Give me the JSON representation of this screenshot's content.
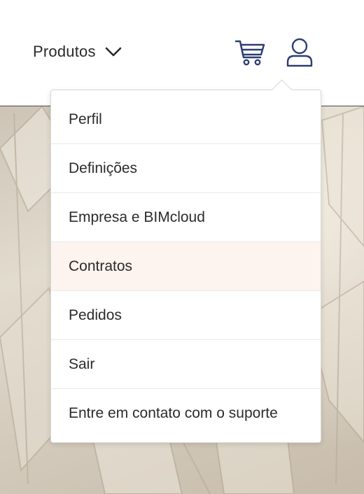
{
  "header": {
    "products_label": "Produtos",
    "products_chevron_icon": "chevron-down-icon",
    "cart_icon": "shopping-cart-icon",
    "user_icon": "user-icon"
  },
  "account_menu": {
    "items": [
      {
        "label": "Perfil",
        "highlighted": false
      },
      {
        "label": "Definições",
        "highlighted": false
      },
      {
        "label": "Empresa e BIMcloud",
        "highlighted": false
      },
      {
        "label": "Contratos",
        "highlighted": true
      },
      {
        "label": "Pedidos",
        "highlighted": false
      },
      {
        "label": "Sair",
        "highlighted": false
      },
      {
        "label": "Entre em contato com o suporte",
        "highlighted": false
      }
    ]
  },
  "colors": {
    "icon": "#2c3e73",
    "text": "#2a2a2a",
    "highlight": "#fdf3ef",
    "divider": "#4a4a4a"
  }
}
